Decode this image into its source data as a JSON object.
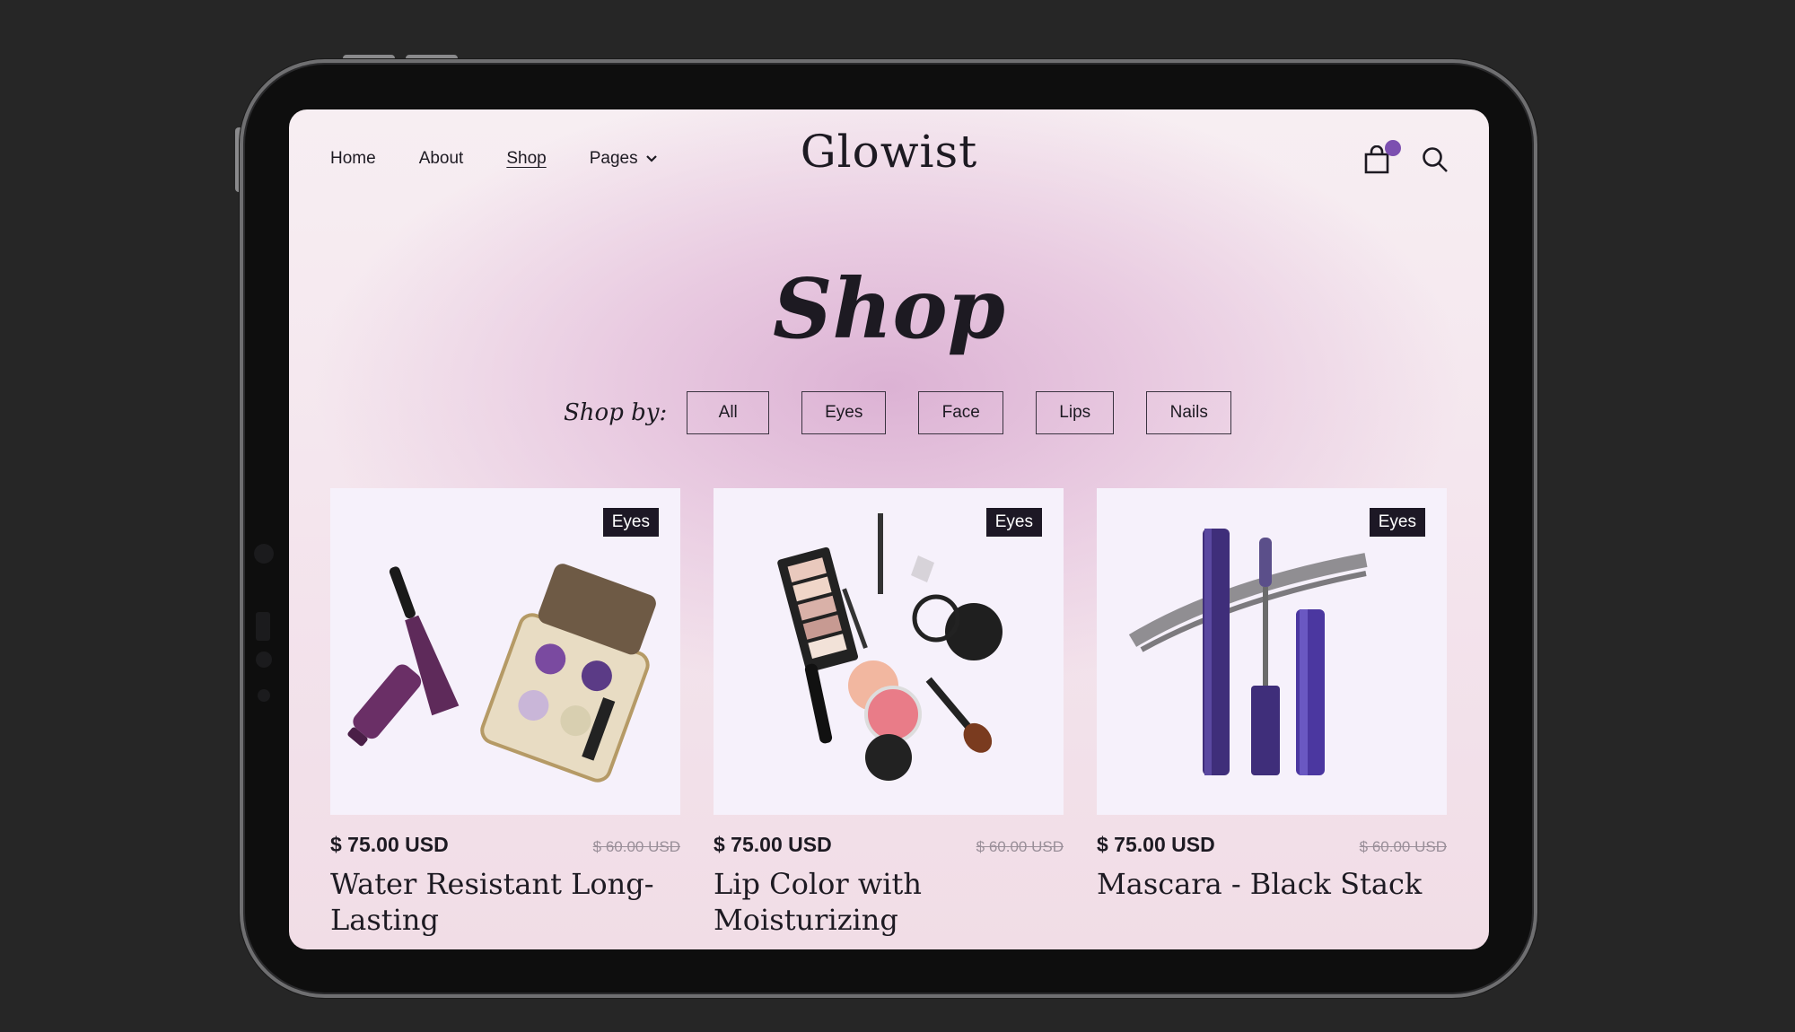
{
  "brand": {
    "logo": "Glowist"
  },
  "nav": {
    "items": [
      "Home",
      "About",
      "Shop",
      "Pages"
    ],
    "active": "Shop"
  },
  "header": {
    "cart_badge_color": "#7c4fb0"
  },
  "page": {
    "title": "Shop"
  },
  "filters": {
    "label": "Shop by:",
    "options": [
      "All",
      "Eyes",
      "Face",
      "Lips",
      "Nails"
    ]
  },
  "products": [
    {
      "badge": "Eyes",
      "price": "$ 75.00 USD",
      "old_price": "$ 60.00 USD",
      "name": "Water Resistant Long-Lasting",
      "image": "mascara-and-eyeshadow-palette"
    },
    {
      "badge": "Eyes",
      "price": "$ 75.00 USD",
      "old_price": "$ 60.00 USD",
      "name": "Lip Color with Moisturizing",
      "image": "makeup-kit-flatlay"
    },
    {
      "badge": "Eyes",
      "price": "$ 75.00 USD",
      "old_price": "$ 60.00 USD",
      "name": "Mascara - Black Stack",
      "image": "mascara-tubes-with-swatch"
    }
  ],
  "colors": {
    "accent": "#7c4fb0",
    "text": "#1d1a22",
    "badge_bg": "#1d1825",
    "card_bg": "#f6f1fb"
  }
}
